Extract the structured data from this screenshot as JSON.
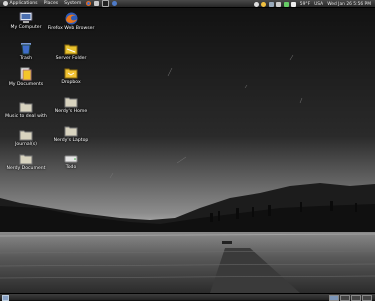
{
  "top_panel": {
    "menus": [
      {
        "label": "Applications",
        "icon": "gnome-foot-icon"
      },
      {
        "label": "Places",
        "icon": "folder-icon"
      },
      {
        "label": "System",
        "icon": "system-icon"
      }
    ],
    "launchers": [
      "firefox-icon",
      "mail-icon",
      "terminal-icon",
      "help-icon"
    ],
    "tray_icons": [
      "user-icon",
      "weather-icon",
      "network-icon",
      "volume-icon",
      "battery-icon",
      "mail-notify-icon"
    ],
    "weather": "59°F",
    "location": "USA",
    "datetime": "Wed Jan 26 5:56 PM",
    "colors": {
      "panel_top": "#4a4a4a",
      "panel_bottom": "#262626"
    }
  },
  "desktop": {
    "icons": [
      {
        "label": "My Computer",
        "icon": "computer-icon"
      },
      {
        "label": "Firefox Web Browser",
        "icon": "firefox-icon"
      },
      {
        "label": "Trash",
        "icon": "trash-icon"
      },
      {
        "label": "Server Folder",
        "icon": "folder-icon"
      },
      {
        "label": "My Documents",
        "icon": "documents-folder-icon"
      },
      {
        "label": "Dropbox",
        "icon": "dropbox-folder-icon"
      },
      {
        "label": "Music to deal with",
        "icon": "folder-icon"
      },
      {
        "label": "Nerdy's Home",
        "icon": "folder-icon"
      },
      {
        "label": "Journal(s)",
        "icon": "folder-icon"
      },
      {
        "label": "Nerdy's Laptop",
        "icon": "folder-icon"
      },
      {
        "label": "Nerdy Document",
        "icon": "folder-icon"
      },
      {
        "label": "Todo",
        "icon": "drive-icon"
      }
    ]
  }
}
